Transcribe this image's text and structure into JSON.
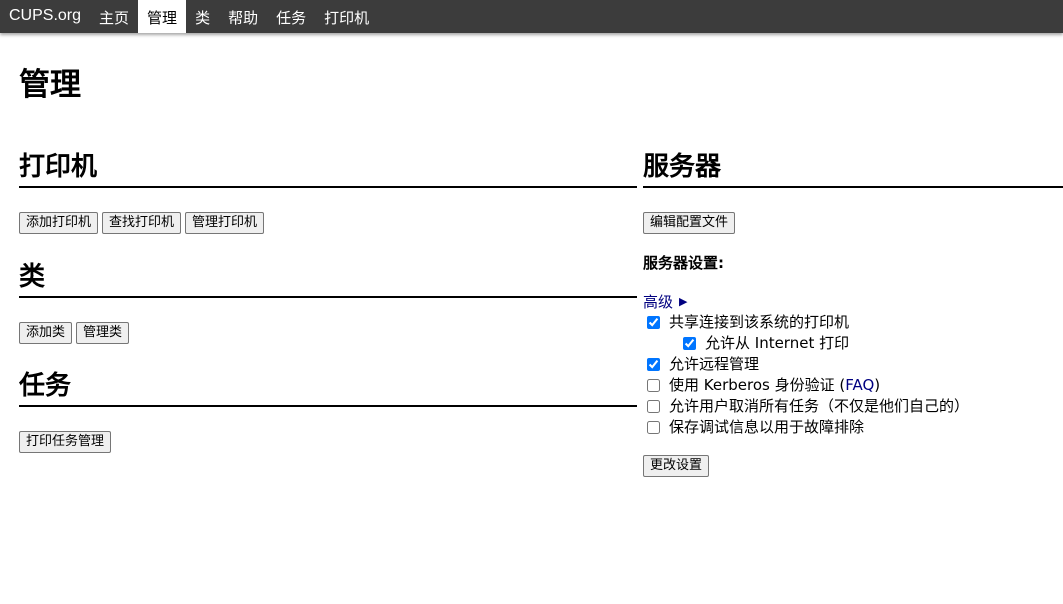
{
  "nav": {
    "brand": "CUPS.org",
    "items": [
      {
        "label": "主页"
      },
      {
        "label": "管理"
      },
      {
        "label": "类"
      },
      {
        "label": "帮助"
      },
      {
        "label": "任务"
      },
      {
        "label": "打印机"
      }
    ]
  },
  "page": {
    "title": "管理"
  },
  "printers": {
    "heading": "打印机",
    "add": "添加打印机",
    "find": "查找打印机",
    "manage": "管理打印机"
  },
  "classes": {
    "heading": "类",
    "add": "添加类",
    "manage": "管理类"
  },
  "jobs": {
    "heading": "任务",
    "manage": "打印任务管理"
  },
  "server": {
    "heading": "服务器",
    "edit_config": "编辑配置文件",
    "settings_heading": "服务器设置:",
    "advanced": "高级",
    "advanced_arrow": "▶",
    "options": {
      "share_printers": {
        "label": "共享连接到该系统的打印机",
        "checked": true
      },
      "allow_internet": {
        "label": "允许从 Internet 打印",
        "checked": true
      },
      "remote_admin": {
        "label": "允许远程管理",
        "checked": true
      },
      "kerberos": {
        "label_prefix": "使用 Kerberos 身份验证 (",
        "link": "FAQ",
        "label_suffix": ")",
        "checked": false
      },
      "cancel_any": {
        "label": "允许用户取消所有任务（不仅是他们自己的）",
        "checked": false
      },
      "debug_log": {
        "label": "保存调试信息以用于故障排除",
        "checked": false
      }
    },
    "change_settings": "更改设置"
  }
}
